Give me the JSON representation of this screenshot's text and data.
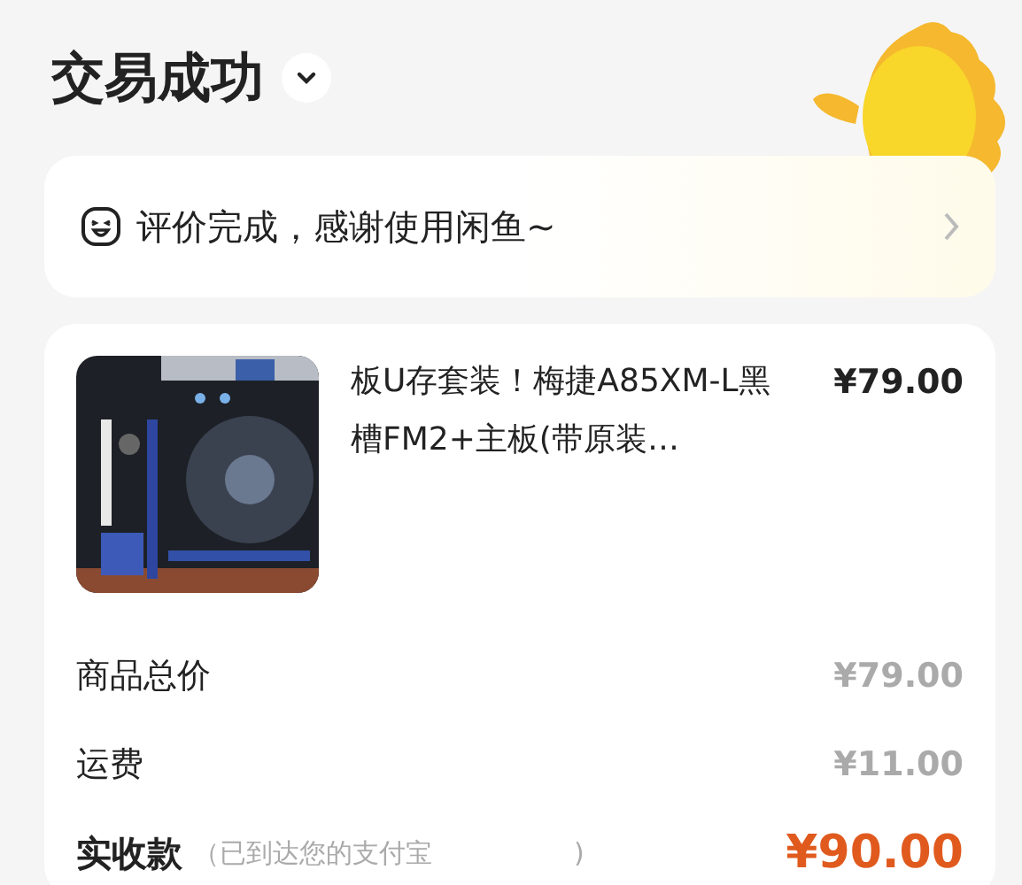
{
  "header": {
    "title": "交易成功"
  },
  "review_banner": {
    "text": "评价完成，感谢使用闲鱼~"
  },
  "item": {
    "title": "板U存套装！梅捷A85XM-L黑槽FM2+主板(带原装…",
    "price": "¥79.00"
  },
  "summary": [
    {
      "kind": "plain",
      "label": "商品总价",
      "value": "¥79.00"
    },
    {
      "kind": "plain",
      "label": "运费",
      "value": "¥11.00"
    },
    {
      "kind": "total",
      "label": "实收款",
      "note": "（已到达您的支付宝",
      "note_end": ")",
      "value": "¥90.00"
    }
  ]
}
